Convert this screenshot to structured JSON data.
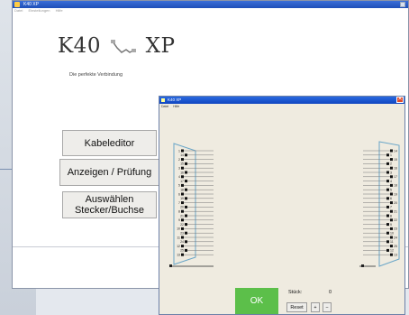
{
  "main": {
    "title": "K40 XP",
    "menu": [
      "Datei",
      "Einstellungen",
      "Hilfe"
    ],
    "logo_left": "K40",
    "logo_right": "XP",
    "tagline": "Die perfekte Verbindung",
    "buttons": {
      "kabeleditor": "Kabeleditor",
      "anzeigen": "Anzeigen / Prüfung",
      "auswaehlen": "Auswählen Stecker/Buchse"
    }
  },
  "dialog": {
    "title": "K40 XP",
    "menu": [
      "Datei",
      "Hilfe"
    ],
    "close_glyph": "✕",
    "ok_label": "OK",
    "stueck_label": "Stück:",
    "stueck_value": "0",
    "reset_label": "Reset",
    "plus_label": "+",
    "minus_label": "−"
  },
  "connectors": {
    "left_pins": [
      "1",
      "14",
      "2",
      "15",
      "3",
      "16",
      "4",
      "17",
      "5",
      "18",
      "6",
      "19",
      "7",
      "20",
      "8",
      "21",
      "9",
      "22",
      "10",
      "23",
      "11",
      "24",
      "12",
      "25",
      "13"
    ],
    "right_pins": [
      "14",
      "1",
      "15",
      "2",
      "16",
      "3",
      "17",
      "4",
      "18",
      "5",
      "19",
      "6",
      "20",
      "7",
      "21",
      "8",
      "22",
      "9",
      "23",
      "10",
      "24",
      "11",
      "25",
      "12",
      "13"
    ]
  },
  "colors": {
    "title_bar": "#1e4fb8",
    "ok_green": "#5cbf4a",
    "connector_outline": "#6aa6c8"
  }
}
